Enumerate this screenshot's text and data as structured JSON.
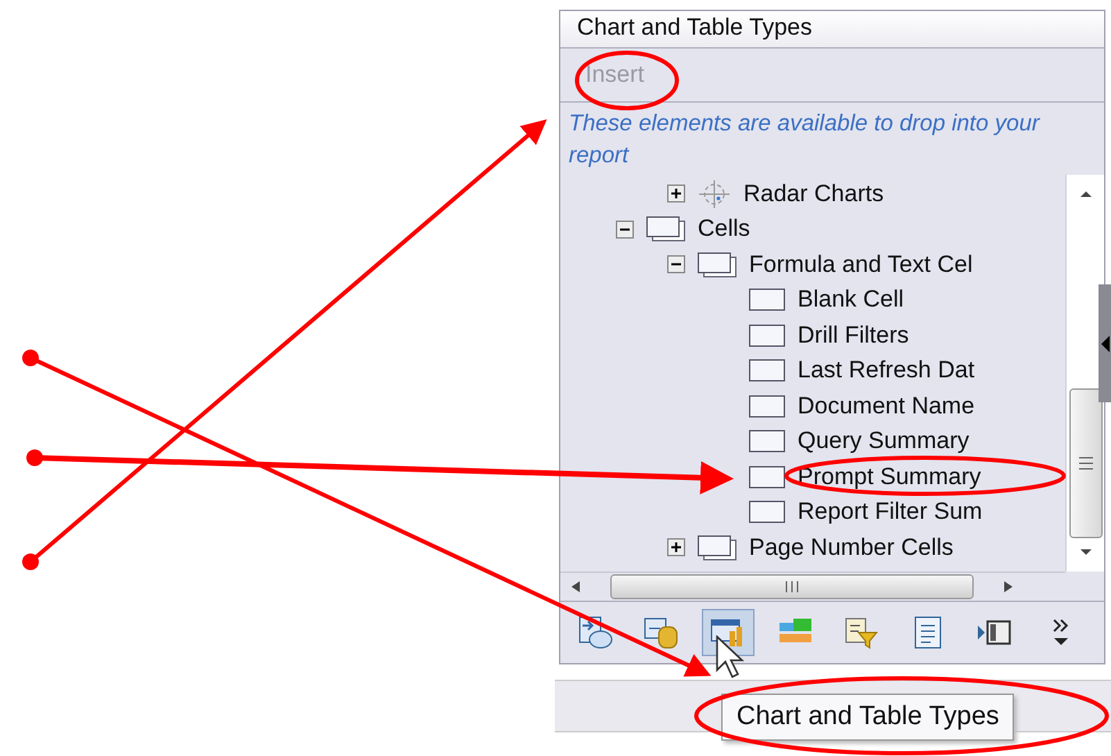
{
  "panel": {
    "title": "Chart and Table Types",
    "insert_button": {
      "label": "Insert",
      "disabled": true
    },
    "description": "These elements are available to drop into your report",
    "tree": [
      {
        "children": [
          {
            "label": "Radar Charts",
            "kind": "radar",
            "expanded": false
          }
        ]
      },
      {
        "label": "Cells",
        "kind": "group",
        "expanded": true,
        "children": [
          {
            "label": "Formula and Text Cel",
            "kind": "group",
            "expanded": true,
            "children": [
              {
                "label": "Blank Cell",
                "kind": "cell"
              },
              {
                "label": "Drill Filters",
                "kind": "cell"
              },
              {
                "label": "Last Refresh Dat",
                "kind": "cell"
              },
              {
                "label": "Document Name",
                "kind": "cell"
              },
              {
                "label": "Query Summary",
                "kind": "cell"
              },
              {
                "label": "Prompt Summary",
                "kind": "cell"
              },
              {
                "label": "Report Filter Sum",
                "kind": "cell"
              }
            ]
          },
          {
            "label": "Page Number Cells",
            "kind": "group",
            "expanded": false
          }
        ]
      }
    ],
    "toolbar": [
      {
        "kind": "report",
        "selected": false
      },
      {
        "kind": "data",
        "selected": false
      },
      {
        "kind": "chart",
        "selected": true
      },
      {
        "kind": "sections",
        "selected": false
      },
      {
        "kind": "filter",
        "selected": false
      },
      {
        "kind": "document",
        "selected": false
      },
      {
        "kind": "navigate",
        "selected": false
      },
      {
        "kind": "more",
        "selected": false
      }
    ]
  },
  "tooltip": "Chart and Table Types"
}
